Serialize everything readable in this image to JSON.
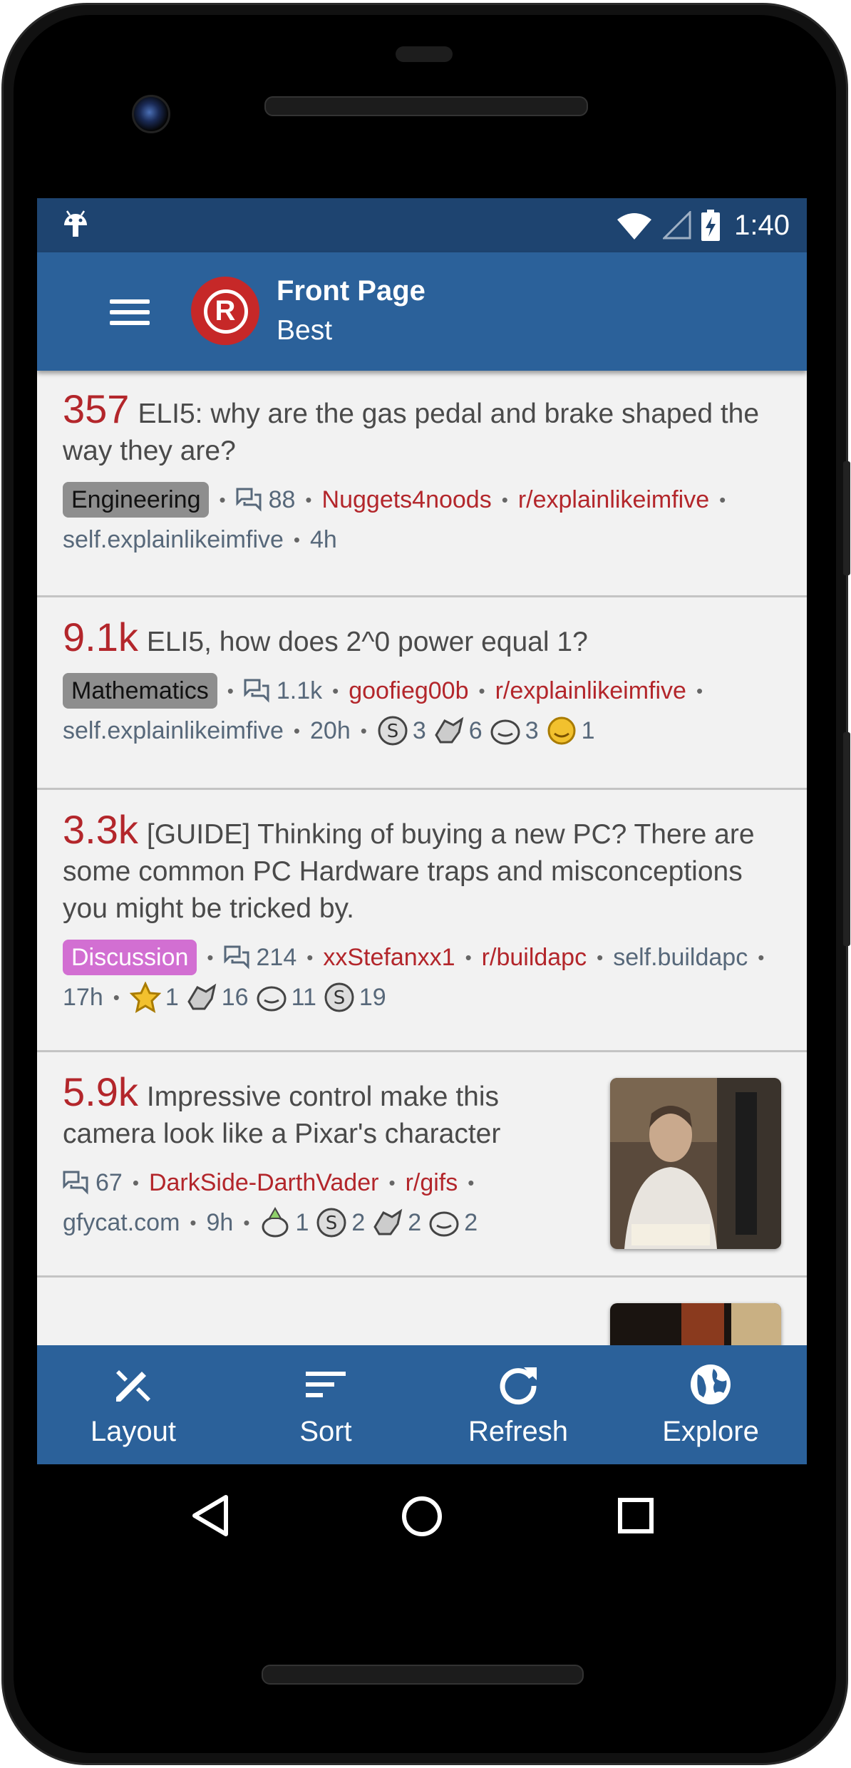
{
  "status_bar": {
    "time": "1:40"
  },
  "app_bar": {
    "title": "Front Page",
    "subtitle": "Best"
  },
  "posts": [
    {
      "score": "357",
      "title": "ELI5: why are the gas pedal and brake shaped the way they are?",
      "flair": "Engineering",
      "comments": "88",
      "author": "Nuggets4noods",
      "subreddit": "r/explainlikeimfive",
      "domain": "self.explainlikeimfive",
      "age": "4h"
    },
    {
      "score": "9.1k",
      "title": "ELI5, how does 2^0 power equal 1?",
      "flair": "Mathematics",
      "comments": "1.1k",
      "author": "goofieg00b",
      "subreddit": "r/explainlikeimfive",
      "domain": "self.explainlikeimfive",
      "age": "20h",
      "awards": [
        {
          "icon": "silver-award-icon",
          "count": "3"
        },
        {
          "icon": "wholesome-award-icon",
          "count": "6"
        },
        {
          "icon": "helpful-award-icon",
          "count": "3"
        },
        {
          "icon": "gold-award-icon",
          "count": "1"
        }
      ]
    },
    {
      "score": "3.3k",
      "title": "[GUIDE] Thinking of buying a new PC? There are some common PC Hardware traps and misconceptions you might be tricked by.",
      "flair": "Discussion",
      "comments": "214",
      "author": "xxStefanxx1",
      "subreddit": "r/buildapc",
      "domain": "self.buildapc",
      "age": "17h",
      "awards": [
        {
          "icon": "gold-award-icon",
          "count": "1"
        },
        {
          "icon": "wholesome-award-icon",
          "count": "16"
        },
        {
          "icon": "helpful-award-icon",
          "count": "11"
        },
        {
          "icon": "silver-award-icon",
          "count": "19"
        }
      ]
    },
    {
      "score": "5.9k",
      "title": "Impressive control make this camera look like a Pixar's character",
      "comments": "67",
      "author": "DarkSide-DarthVader",
      "subreddit": "r/gifs",
      "domain": "gfycat.com",
      "age": "9h",
      "awards": [
        {
          "icon": "party-award-icon",
          "count": "1"
        },
        {
          "icon": "silver-award-icon",
          "count": "2"
        },
        {
          "icon": "wholesome-award-icon",
          "count": "2"
        },
        {
          "icon": "helpful-award-icon",
          "count": "2"
        }
      ]
    }
  ],
  "bottom_nav": [
    {
      "label": "Layout",
      "icon": "layout-icon"
    },
    {
      "label": "Sort",
      "icon": "sort-icon"
    },
    {
      "label": "Refresh",
      "icon": "refresh-icon"
    },
    {
      "label": "Explore",
      "icon": "explore-icon"
    }
  ],
  "colors": {
    "primary": "#2b619a",
    "status_bar": "#1e4470",
    "score": "#b3262b",
    "logo": "#c62828"
  }
}
